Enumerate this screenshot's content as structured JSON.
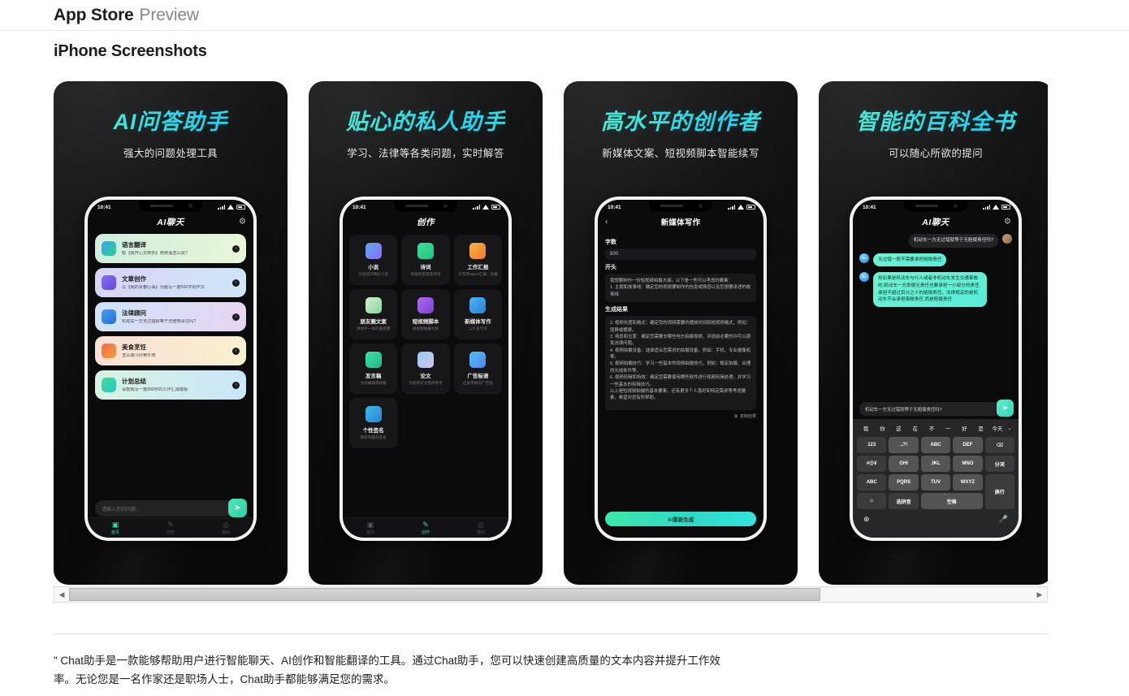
{
  "header": {
    "brand": "App Store",
    "section": "Preview"
  },
  "page_title": "iPhone Screenshots",
  "status_bar": {
    "time": "10:41"
  },
  "screenshots": [
    {
      "title": "AI问答助手",
      "subtitle": "强大的问题处理工具",
      "nav_title": "AI聊天",
      "gear_icon": "⚙",
      "cards": [
        {
          "title": "语言翻译",
          "desc": "帮【我开心又到你】用英语怎么说?",
          "go": "›"
        },
        {
          "title": "文章创作",
          "desc": "以【我的青春心事】为题写一篇500字的作文",
          "go": "›"
        },
        {
          "title": "法律顾问",
          "desc": "机动车一方无过错就等于无赔偿责任吗?",
          "go": "›"
        },
        {
          "title": "美食烹饪",
          "desc": "怎么做小炒黄牛肉",
          "go": "›"
        },
        {
          "title": "计划总结",
          "desc": "请帮我写一篇300字的工作汇报模板",
          "go": "›"
        }
      ],
      "input_placeholder": "请输入您的问题...",
      "send_icon": "➤",
      "tabs": [
        {
          "icon": "▣",
          "label": "首页",
          "active": true
        },
        {
          "icon": "✎",
          "label": "创作",
          "active": false
        },
        {
          "icon": "◎",
          "label": "我的",
          "active": false
        }
      ]
    },
    {
      "title": "贴心的私人助手",
      "subtitle": "学习、法律等各类问题，实时解答",
      "nav_title": "创作",
      "grid": [
        {
          "title": "小说",
          "desc": "为您续写精彩小说"
        },
        {
          "title": "诗词",
          "desc": "智能构思提笔诗词"
        },
        {
          "title": "工作汇报",
          "desc": "工作周report汇报、日报"
        },
        {
          "title": "朋友圈文案",
          "desc": "讲述不一样的朋友圈"
        },
        {
          "title": "短视频脚本",
          "desc": "短视频拍摄大纲"
        },
        {
          "title": "新媒体写作",
          "desc": "公众号写作"
        },
        {
          "title": "发言稿",
          "desc": "为您编辑演讲稿"
        },
        {
          "title": "论文",
          "desc": "为您的论文提供参考"
        },
        {
          "title": "广告标语",
          "desc": "应发惊艳的广告语"
        },
        {
          "title": "个性签名",
          "desc": "制作有趣的签名"
        }
      ],
      "tabs": [
        {
          "icon": "▣",
          "label": "首页",
          "active": false
        },
        {
          "icon": "✎",
          "label": "创作",
          "active": true
        },
        {
          "icon": "◎",
          "label": "我的",
          "active": false
        }
      ]
    },
    {
      "title": "高水平的创作者",
      "subtitle": "新媒体文案、短视频脚本智能续写",
      "nav_title": "新媒体写作",
      "back_icon": "‹",
      "fields": [
        {
          "label": "字数",
          "value": "500"
        },
        {
          "label": "开头",
          "value": "我想要制作一份短视频拍摄大纲，以下是一些可以考虑的要素：\n1. 主题和故事线：确定您的视频要制作的信息或情感以及您想要讲述的故事线"
        }
      ],
      "result_label": "生成结果",
      "result_text": "2. 视频长度和格式：确定您的视频需要的播放时间和短视频格式，例如：竖屏或横屏。\n3. 场景和位置：确定您需要去哪些地方拍摄视频，并提前必要的许可以避免法律问题。\n4. 视频拍摄设备：选择适合您需求的拍摄设备，例如：手机、专业摄像机等。\n5. 视频拍摄技巧：学习一些基本的视频拍摄技巧，例如：稳定拍摄、合理的光线条件等。\n6. 视频剪辑和特效：确定您需要使用哪些软件进行视频剪辑处理，并学习一些基本的剪辑技巧。\n以上是短视频拍摄的基本要素，还有更多个人喜好和特定需求等考虑要素，希望对您有所帮助。",
      "copy_label": "复制结果",
      "copy_icon": "⧉",
      "regen_label": "AI重新生成"
    },
    {
      "title": "智能的百科全书",
      "subtitle": "可以随心所欲的提问",
      "nav_title": "AI聊天",
      "gear_icon": "⚙",
      "messages": [
        {
          "from": "user",
          "text": "机动车一方无过错就等于无赔偿责任吗?"
        },
        {
          "from": "ai",
          "text": "无过错一般不需要承担赔偿责任"
        },
        {
          "from": "ai",
          "text": "但如果是机动车与行人或者非机动车发生交通事故的,机动车一方即便无责任也要承担一小部分的责任,承担不超过百分之十的赔偿责任。法律规定的是机动车不会承担事故责任,而是赔偿责任"
        }
      ],
      "input_value": "机动车一方无过错就等于无赔偿责任吗?",
      "send_icon": "➤",
      "keyboard": {
        "predictions": [
          "我",
          "你",
          "这",
          "在",
          "不",
          "一",
          "好",
          "是",
          "今天"
        ],
        "chevron": "⌄",
        "keys": [
          {
            "label": "123",
            "dark": true
          },
          {
            "label": ".,?!",
            "dark": false
          },
          {
            "label": "ABC",
            "dark": false
          },
          {
            "label": "DEF",
            "dark": false
          },
          {
            "label": "⌫",
            "dark": true
          },
          {
            "label": "#@¥",
            "dark": true
          },
          {
            "label": "GHI",
            "dark": false
          },
          {
            "label": "JKL",
            "dark": false
          },
          {
            "label": "MNO",
            "dark": false
          },
          {
            "label": "分词",
            "dark": true
          },
          {
            "label": "ABC",
            "dark": true
          },
          {
            "label": "PQRS",
            "dark": false
          },
          {
            "label": "TUV",
            "dark": false
          },
          {
            "label": "WXYZ",
            "dark": false
          },
          {
            "label": "换行",
            "dark": true
          },
          {
            "label": "☺",
            "dark": true
          },
          {
            "label": "选拼音",
            "dark": true
          },
          {
            "label": "空格",
            "dark": false
          }
        ],
        "globe_icon": "⊕",
        "mic_icon": "🎤"
      }
    }
  ],
  "scrollbar": {
    "left_arrow": "◀",
    "right_arrow": "▶",
    "thumb_percent": 78
  },
  "description": "\" Chat助手是一款能够帮助用户进行智能聊天、AI创作和智能翻译的工具。通过Chat助手，您可以快速创建高质量的文本内容并提升工作效率。无论您是一名作家还是职场人士，Chat助手都能够满足您的需求。"
}
